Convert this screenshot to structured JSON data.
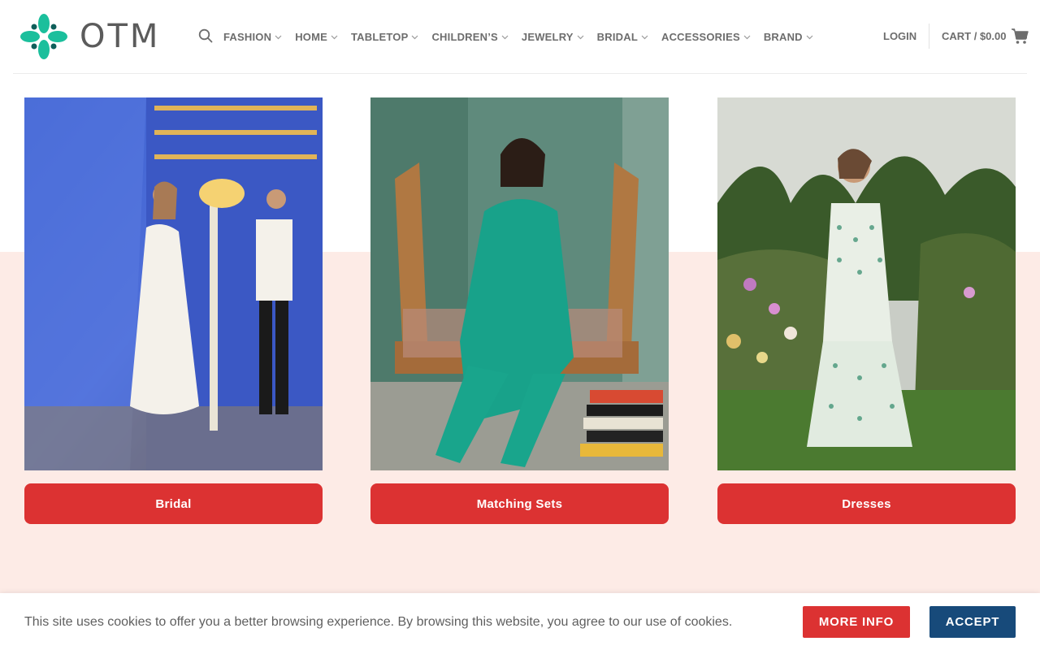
{
  "brand": {
    "logo_text": "OTM",
    "accent": "#1bbf9c",
    "logo_dot": "#0f5f5a"
  },
  "header": {
    "search_icon": "search-icon",
    "nav": [
      {
        "label": "FASHION"
      },
      {
        "label": "HOME"
      },
      {
        "label": "TABLETOP"
      },
      {
        "label": "CHILDREN’S"
      },
      {
        "label": "JEWELRY"
      },
      {
        "label": "BRIDAL"
      },
      {
        "label": "ACCESSORIES"
      },
      {
        "label": "BRAND"
      }
    ],
    "login_label": "LOGIN",
    "cart_label": "CART / $0.00",
    "cart_icon": "cart-icon"
  },
  "categories": [
    {
      "label": "Bridal",
      "image": "bride-and-groom-mosaic-photo"
    },
    {
      "label": "Matching Sets",
      "image": "woman-green-satin-set-photo"
    },
    {
      "label": "Dresses",
      "image": "woman-green-print-dress-garden-photo"
    }
  ],
  "cookie": {
    "message": "This site uses cookies to offer you a better browsing experience. By browsing this website, you agree to our use of cookies.",
    "more_info_label": "MORE INFO",
    "accept_label": "ACCEPT"
  },
  "colors": {
    "button_red": "#dc3232",
    "accept_blue": "#174a7a",
    "pink_band": "#fdebe6",
    "nav_text": "#6d6d6d"
  }
}
